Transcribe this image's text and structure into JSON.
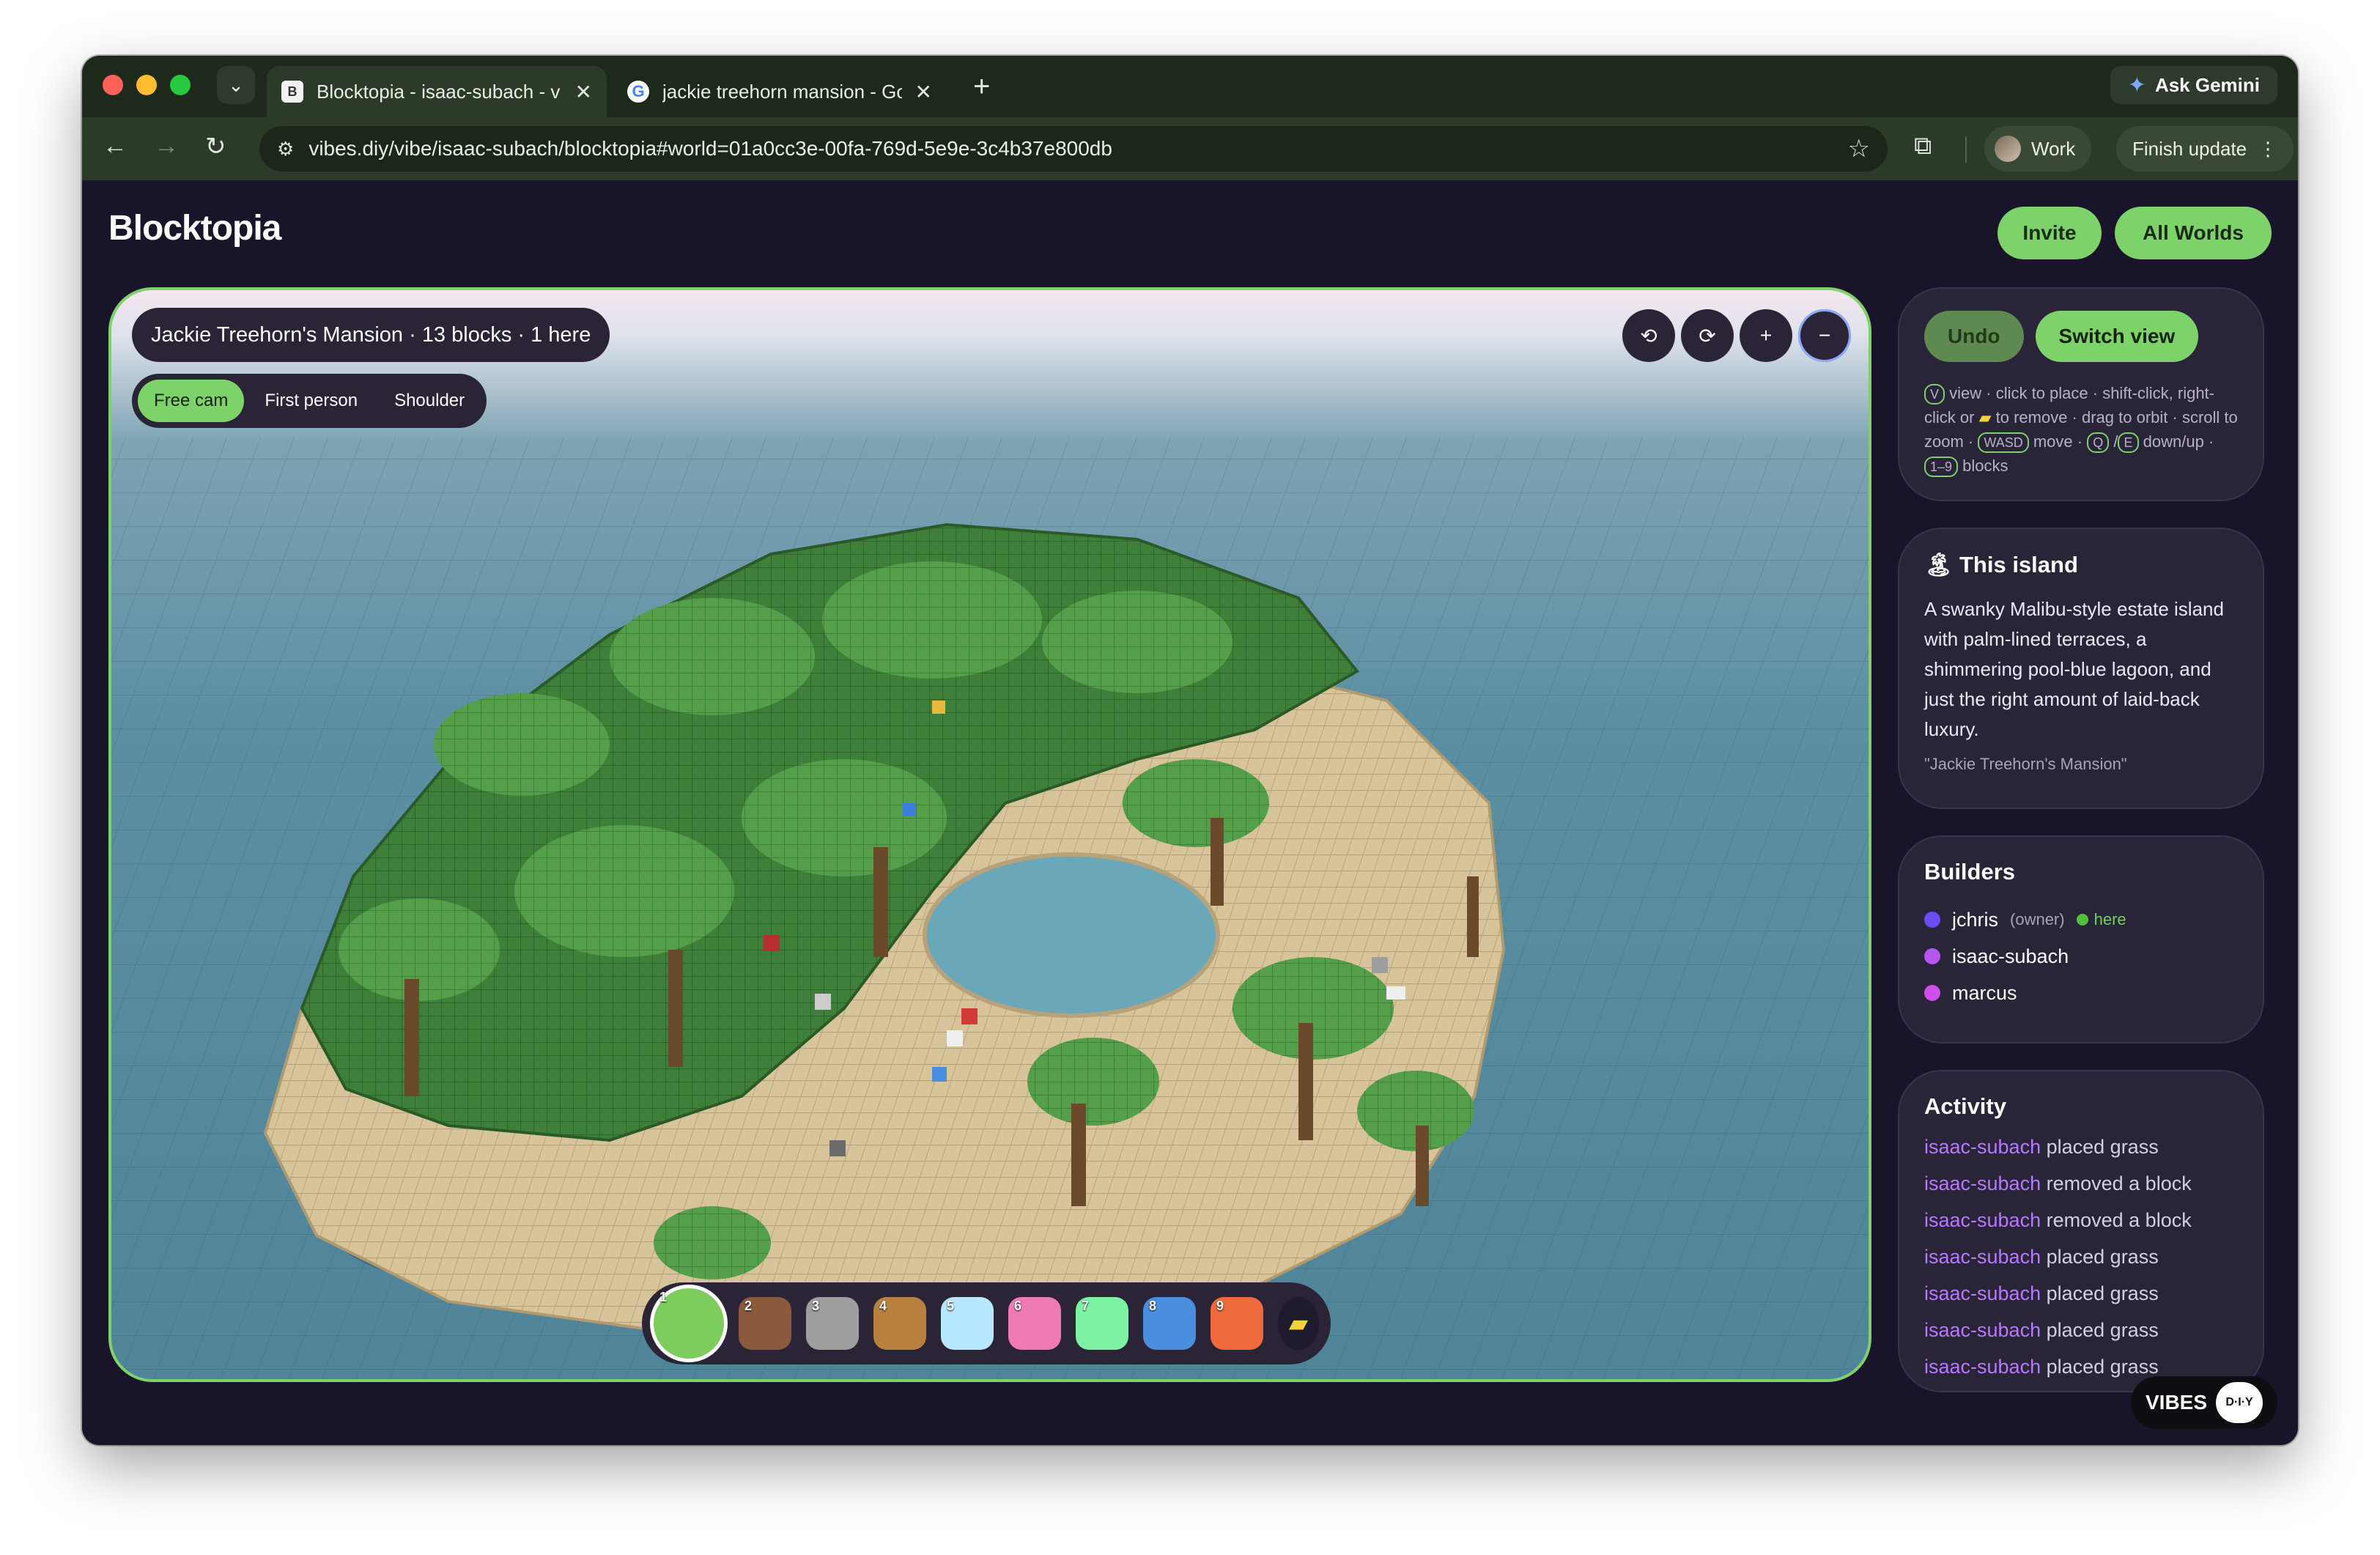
{
  "browser": {
    "tabs": [
      {
        "title": "Blocktopia - isaac-subach - v",
        "favicon": "B",
        "active": true
      },
      {
        "title": "jackie treehorn mansion - Go",
        "favicon": "G",
        "active": false
      }
    ],
    "ask_gemini": "Ask Gemini",
    "url": "vibes.diy/vibe/isaac-subach/blocktopia#world=01a0cc3e-00fa-769d-5e9e-3c4b37e800db",
    "profile": "Work",
    "finish_update": "Finish update"
  },
  "app": {
    "title": "Blocktopia",
    "invite": "Invite",
    "all_worlds": "All Worlds"
  },
  "viewport": {
    "world_info": "Jackie Treehorn's Mansion · 13 blocks · 1 here",
    "camera_modes": [
      "Free cam",
      "First person",
      "Shoulder"
    ],
    "selected_mode": "Free cam",
    "controls": {
      "rotate_left": "⟲",
      "rotate_right": "⟳",
      "zoom_in": "+",
      "zoom_out": "−"
    }
  },
  "palette": {
    "selected": 1,
    "swatches": [
      {
        "num": "1",
        "color": "#7ccd5e"
      },
      {
        "num": "2",
        "color": "#8b5a3c"
      },
      {
        "num": "3",
        "color": "#9e9e9e"
      },
      {
        "num": "4",
        "color": "#b7803f"
      },
      {
        "num": "5",
        "color": "#b8e8ff"
      },
      {
        "num": "6",
        "color": "#f07ab5"
      },
      {
        "num": "7",
        "color": "#7cf2a2"
      },
      {
        "num": "8",
        "color": "#4a8ee0"
      },
      {
        "num": "9",
        "color": "#ef6a3c"
      }
    ],
    "eraser_icon": "eraser-icon"
  },
  "sidebar": {
    "undo": "Undo",
    "switch_view": "Switch view",
    "hint": {
      "k1": "V",
      "t1": "view · click to place · shift-click, right-click or",
      "t2": "to remove · drag to orbit · scroll to zoom ·",
      "k2": "WASD",
      "t3": "move ·",
      "k3": "Q",
      "t4": "/",
      "k4": "E",
      "t5": "down/up ·",
      "k5": "1–9",
      "t6": "blocks"
    },
    "island": {
      "icon": "🏝",
      "title": "This island",
      "description": "A swanky Malibu-style estate island with palm-lined terraces, a shimmering pool-blue lagoon, and just the right amount of laid-back luxury.",
      "quote": "\"Jackie Treehorn's Mansion\""
    },
    "builders": {
      "title": "Builders",
      "list": [
        {
          "name": "jchris",
          "owner": "(owner)",
          "here": "here",
          "color": "#6b4cf5"
        },
        {
          "name": "isaac-subach",
          "owner": "",
          "here": "",
          "color": "#b457f0"
        },
        {
          "name": "marcus",
          "owner": "",
          "here": "",
          "color": "#d04fe8"
        }
      ]
    },
    "activity": {
      "title": "Activity",
      "items": [
        {
          "user": "isaac-subach",
          "action": "placed grass"
        },
        {
          "user": "isaac-subach",
          "action": "removed a block"
        },
        {
          "user": "isaac-subach",
          "action": "removed a block"
        },
        {
          "user": "isaac-subach",
          "action": "placed grass"
        },
        {
          "user": "isaac-subach",
          "action": "placed grass"
        },
        {
          "user": "isaac-subach",
          "action": "placed grass"
        },
        {
          "user": "isaac-subach",
          "action": "placed grass"
        }
      ]
    }
  },
  "badge": {
    "vibes": "VIBES",
    "diy": "D·I·Y"
  },
  "colors": {
    "accent": "#7ed26a",
    "background": "#19142a",
    "card": "#2a2438",
    "user": "#b679ff"
  }
}
